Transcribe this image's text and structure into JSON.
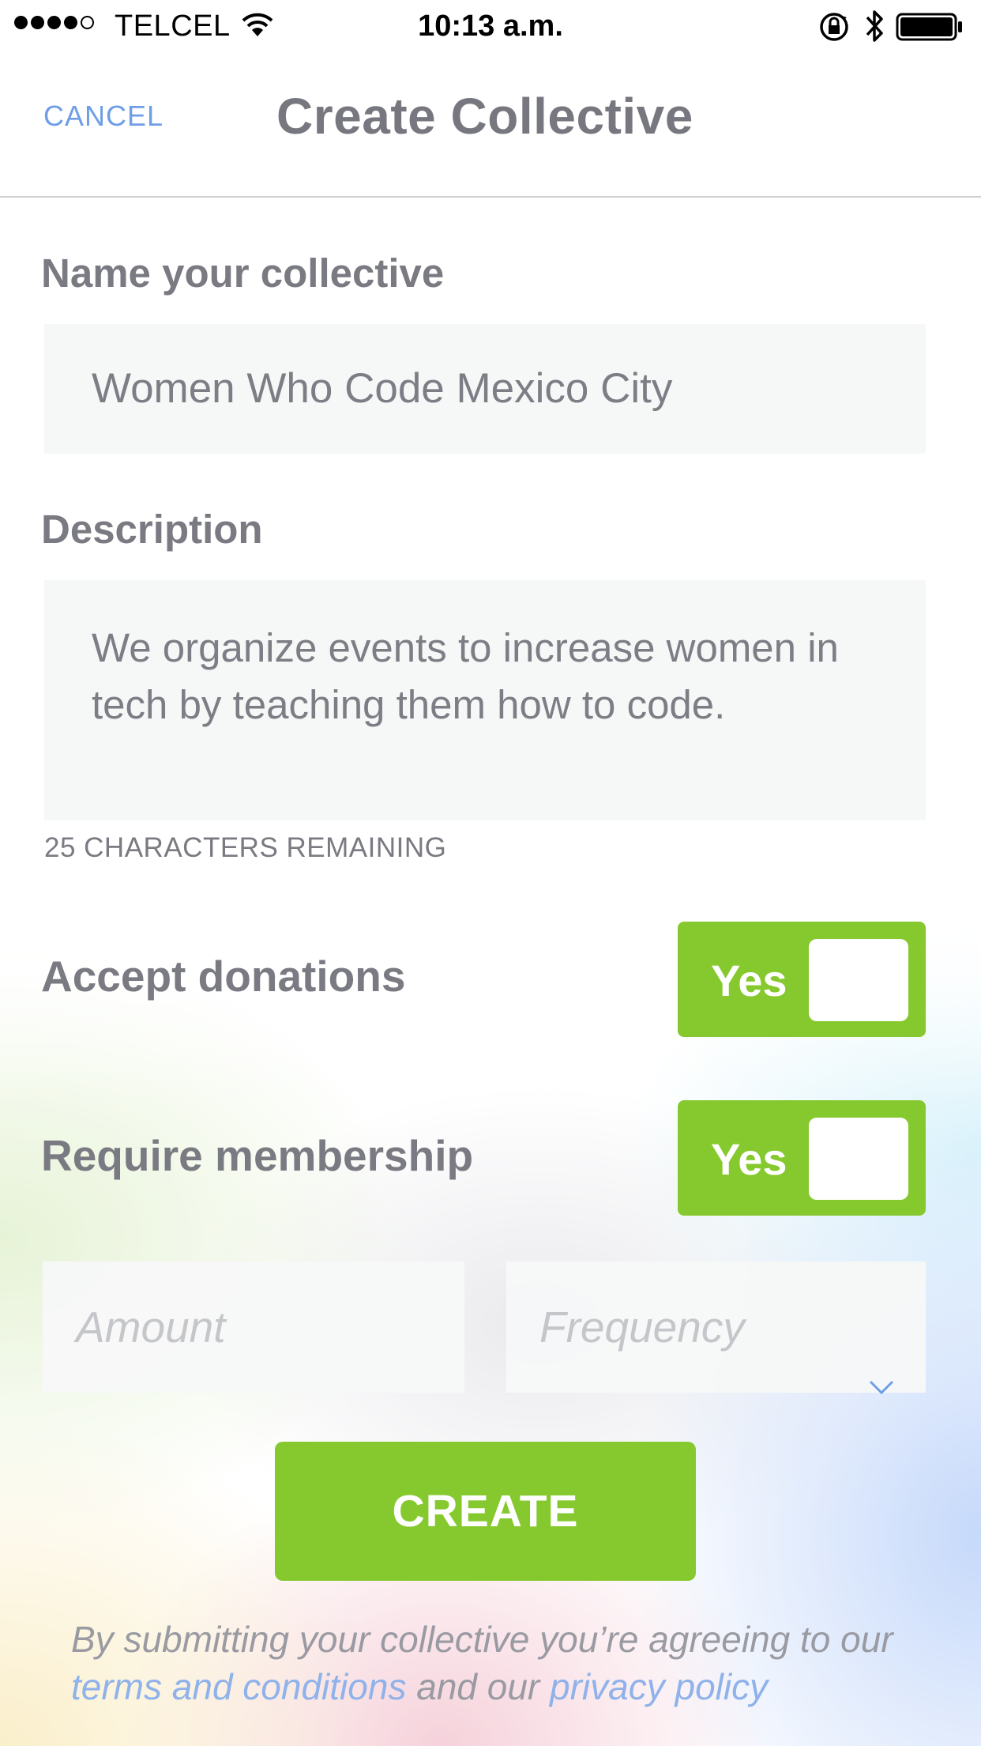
{
  "status_bar": {
    "carrier": "TELCEL",
    "time": "10:13 a.m.",
    "signal_bars": 4,
    "signal_total": 5
  },
  "nav": {
    "cancel_label": "CANCEL",
    "title": "Create Collective"
  },
  "form": {
    "name_label": "Name your collective",
    "name_value": "Women Who Code Mexico City",
    "description_label": "Description",
    "description_value": "We organize events to increase women in tech by teaching them how to code.",
    "characters_remaining": "25 CHARACTERS REMAINING",
    "accept_donations_label": "Accept donations",
    "accept_donations_value": "Yes",
    "require_membership_label": "Require membership",
    "require_membership_value": "Yes",
    "amount_placeholder": "Amount",
    "frequency_placeholder": "Frequency",
    "create_label": "CREATE"
  },
  "legal": {
    "prefix": "By submitting your collective you’re agreeing to our ",
    "terms_link": "terms and conditions",
    "middle": " and our ",
    "privacy_link": "privacy policy"
  },
  "colors": {
    "accent_green": "#86c92f",
    "link_blue": "#6f9ee6",
    "text_gray": "#7a7a82"
  },
  "icons": [
    "wifi-icon",
    "rotation-lock-icon",
    "bluetooth-icon",
    "battery-icon",
    "chevron-down-icon"
  ]
}
